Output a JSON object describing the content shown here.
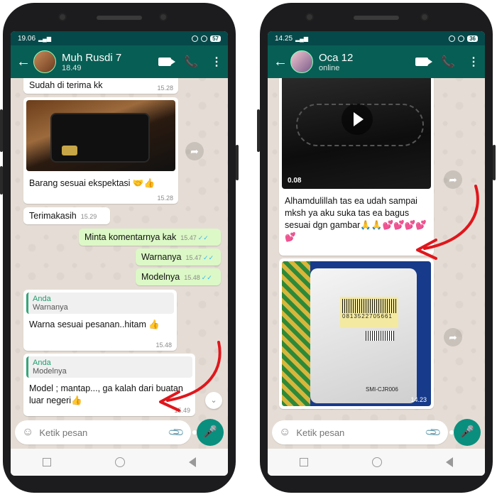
{
  "left_phone": {
    "status_time": "19.06",
    "battery": "57",
    "contact_name": "Muh Rusdi 7",
    "contact_sub": "18.49",
    "messages": {
      "m1_text": "Sudah di terima kk",
      "m1_time": "15.28",
      "m2_caption": "Barang sesuai ekspektasi 🤝👍",
      "m2_time": "15.28",
      "m3_text": "Terimakasih",
      "m3_time": "15.29",
      "m4_text": "Minta komentarnya kak",
      "m4_time": "15.47",
      "m5_text": "Warnanya",
      "m5_time": "15.47",
      "m6_text": "Modelnya",
      "m6_time": "15.48",
      "m7_quote_name": "Anda",
      "m7_quote_text": "Warnanya",
      "m7_text": "Warna sesuai pesanan..hitam 👍",
      "m7_time": "15.48",
      "m8_quote_name": "Anda",
      "m8_quote_text": "Modelnya",
      "m8_text": "Model ; mantap..., ga kalah dari buatan luar negeri👍",
      "m8_time": "15.49"
    },
    "input_placeholder": "Ketik pesan"
  },
  "right_phone": {
    "status_time": "14.25",
    "battery": "36",
    "contact_name": "Oca 12",
    "contact_sub": "online",
    "messages": {
      "video_duration": "0.08",
      "video_caption": "Alhamdulillah tas ea udah sampai mksh ya aku suka tas ea bagus sesuai dgn gambar🙏🙏💕💕💕💕💕",
      "photo_label_line": "SMI-CJR006",
      "photo_barcode_text": "0813522705661",
      "photo_time": "14.23"
    },
    "input_placeholder": "Ketik pesan"
  },
  "icons": {
    "back": "←",
    "call": "📞",
    "menu": "⋮",
    "forward": "➦",
    "scroll_down": "⌄",
    "emoji": "☺",
    "clip": "📎",
    "mic": "🎤"
  },
  "colors": {
    "header": "#075e54",
    "status_bar": "#06494a",
    "outgoing_bubble": "#dcf8c6",
    "incoming_bubble": "#ffffff",
    "mic_button": "#0a8f7e",
    "annotation_arrow": "#e0161c"
  }
}
